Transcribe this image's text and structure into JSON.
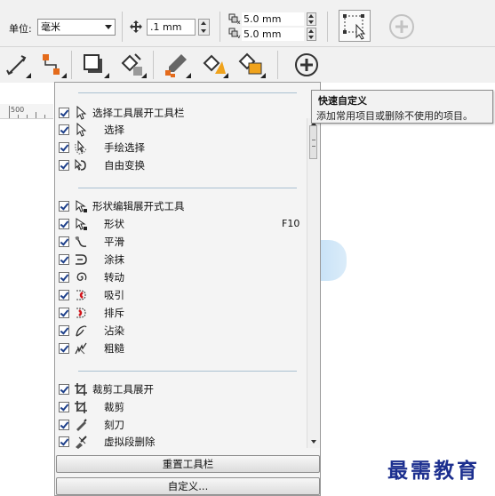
{
  "property_bar": {
    "unit_label": "单位:",
    "unit_value": "毫米",
    "nudge_value": ".1 mm",
    "dup_x": "5.0 mm",
    "dup_y": "5.0 mm"
  },
  "ruler": {
    "label": "500"
  },
  "menu": {
    "groups": [
      {
        "header": "选择工具展开工具栏",
        "items": [
          {
            "label": "选择"
          },
          {
            "label": "手绘选择"
          },
          {
            "label": "自由变换"
          }
        ]
      },
      {
        "header": "形状编辑展开式工具",
        "items": [
          {
            "label": "形状",
            "key": "F10"
          },
          {
            "label": "平滑"
          },
          {
            "label": "涂抹"
          },
          {
            "label": "转动"
          },
          {
            "label": "吸引"
          },
          {
            "label": "排斥"
          },
          {
            "label": "沾染"
          },
          {
            "label": "粗糙"
          }
        ]
      },
      {
        "header": "裁剪工具展开",
        "items": [
          {
            "label": "裁剪"
          },
          {
            "label": "刻刀"
          },
          {
            "label": "虚拟段删除"
          }
        ]
      }
    ],
    "reset_button": "重置工具栏",
    "customize_button": "自定义..."
  },
  "tooltip": {
    "title": "快速自定义",
    "body": "添加常用项目或删除不使用的项目。"
  },
  "watermark": "最需教育",
  "colors": {
    "menu_separator": "#a9c0d1",
    "watermark": "#1c2f8f",
    "check": "#1d3f8a"
  }
}
